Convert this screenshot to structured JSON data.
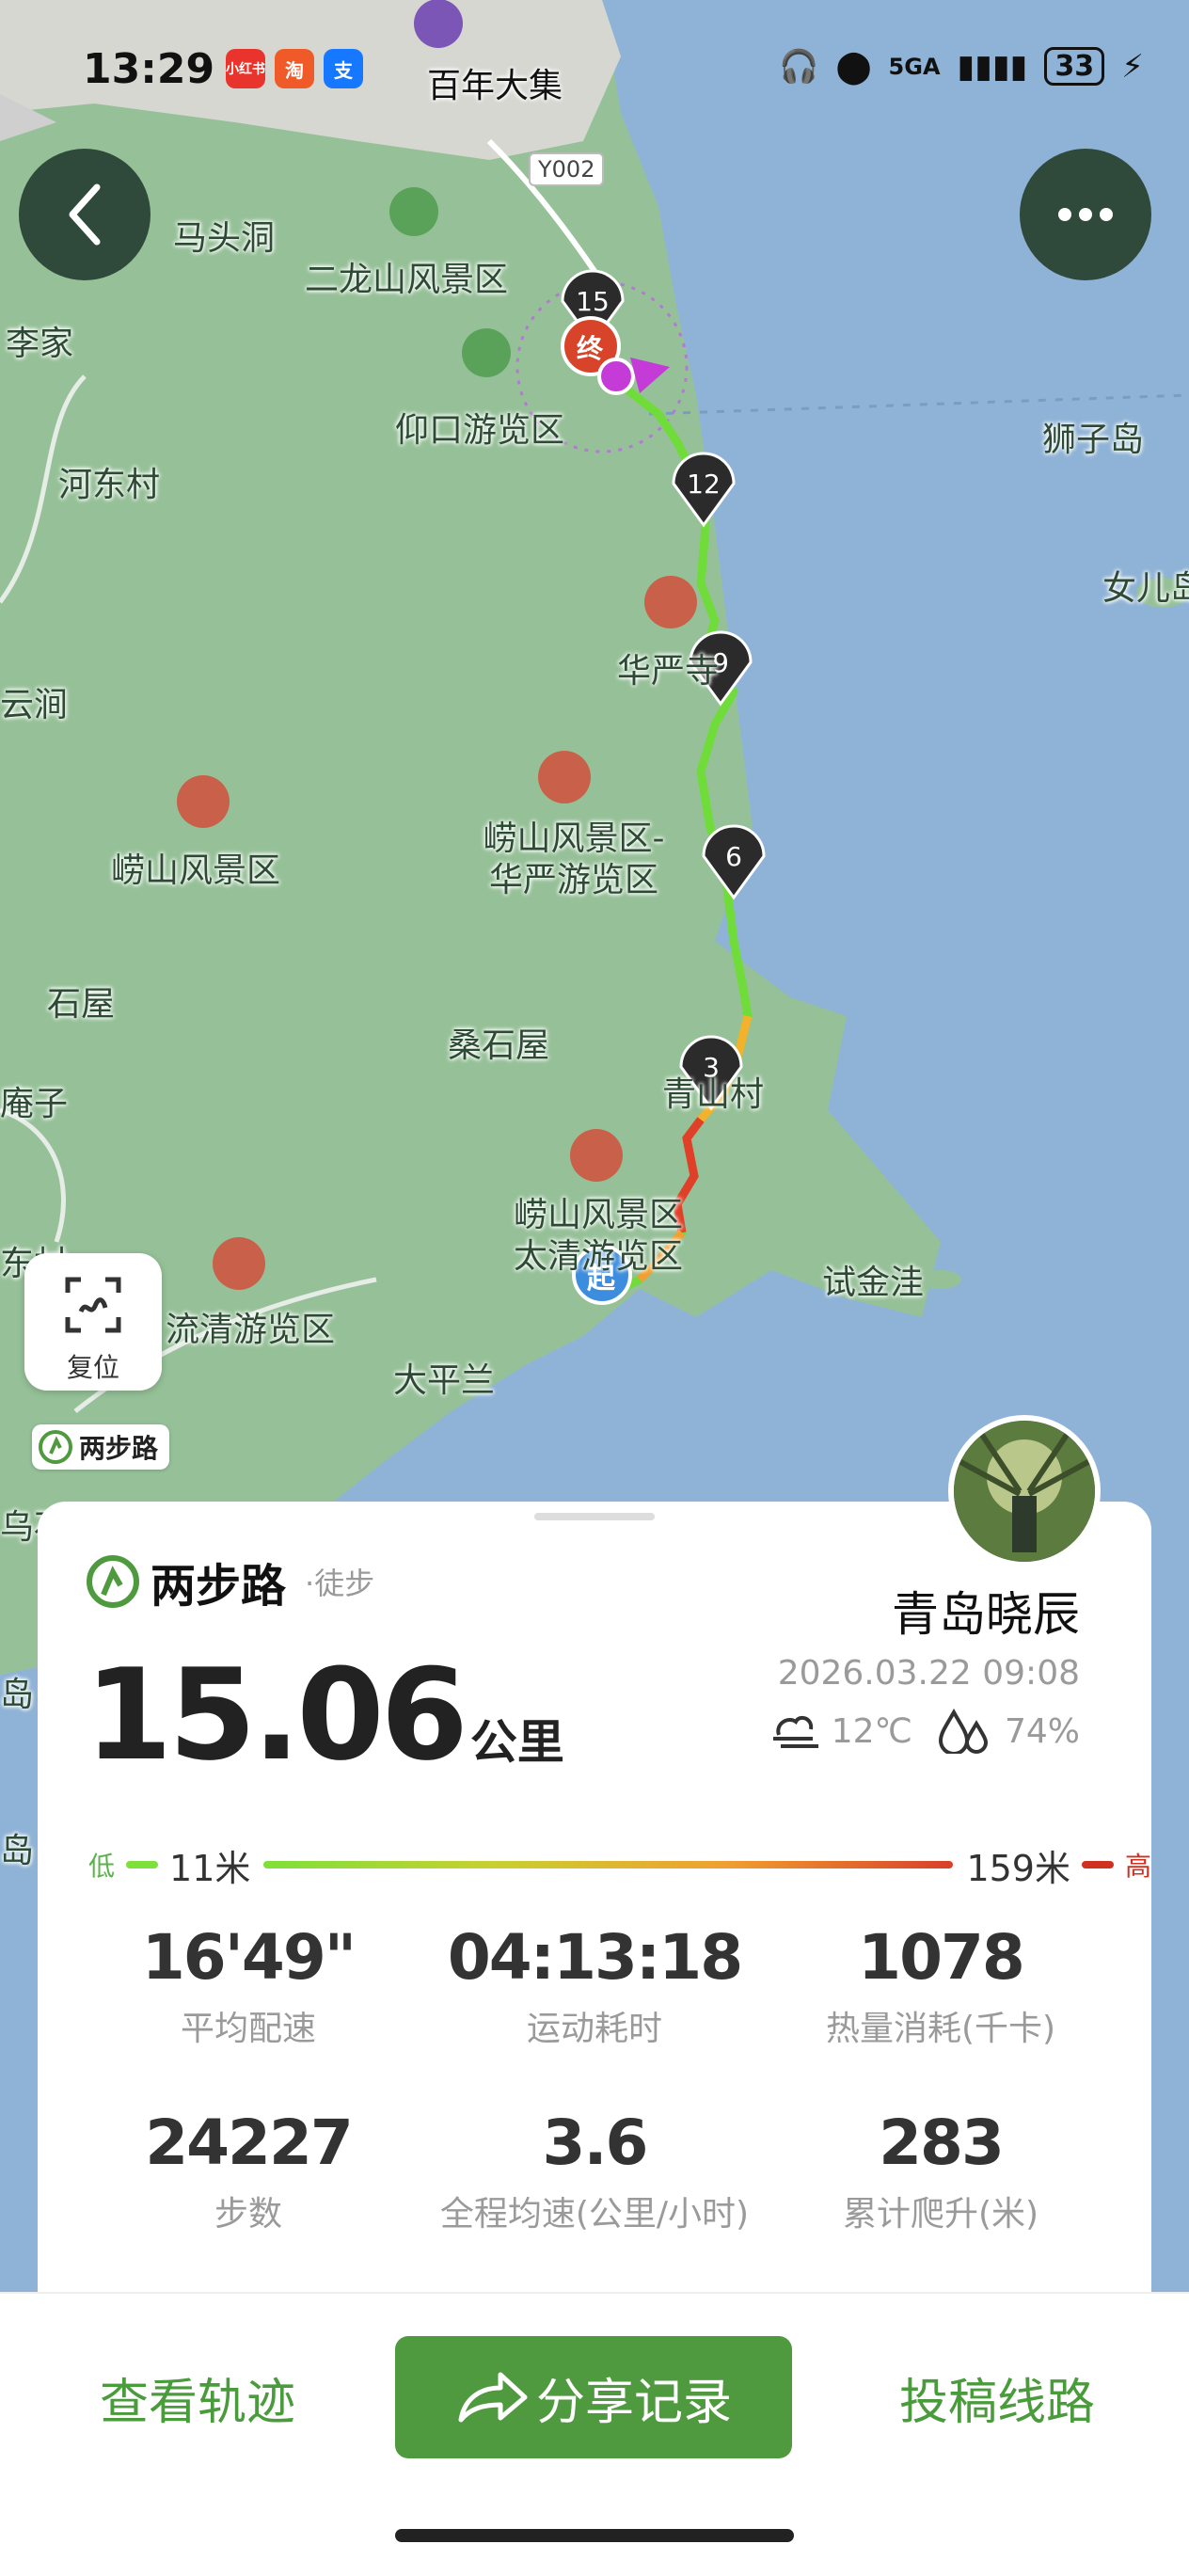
{
  "status_bar": {
    "time": "13:29",
    "apps": [
      "小红书",
      "淘",
      "支"
    ],
    "network": "5GA",
    "battery": "33"
  },
  "map": {
    "labels": {
      "top_market": "百年大集",
      "road": "Y002",
      "matouwa": "马头洞",
      "erlongshan": "二龙山风景区",
      "lijia": "李家",
      "yangkou": "仰口游览区",
      "shizidao": "狮子岛",
      "hedong": "河东村",
      "nvdao": "女儿岛",
      "yunjian": "云涧",
      "huayan": "华严寺",
      "laoshan": "崂山风景区",
      "laoshan_huayan": "崂山风景区-华严游览区",
      "shiwu": "石屋",
      "sangshiwu": "桑石屋",
      "qingshancun": "青山村",
      "anzi": "庵子",
      "laoshan_taiqing": "崂山风景区太清游览区",
      "shijinwa": "试金洼",
      "dongcun": "东村",
      "liuqing": "流清游览区",
      "taipinglan": "大平兰",
      "wu": "乌石",
      "dao": "岛",
      "dao2": "岛"
    },
    "markers": [
      "15",
      "12",
      "9",
      "6",
      "3"
    ],
    "start_label": "起",
    "end_label": "终"
  },
  "reset": {
    "label": "复位"
  },
  "watermark": {
    "label": "两步路"
  },
  "card": {
    "brand": "两步路",
    "activity_type": "·徒步",
    "username": "青岛晓辰",
    "distance": "15.06",
    "distance_unit": "公里",
    "datetime": "2026.03.22 09:08",
    "temperature": "12℃",
    "humidity": "74%",
    "elevation": {
      "low_label": "低",
      "high_label": "高",
      "min": "11米",
      "max": "159米"
    },
    "stats": [
      {
        "value": "16'49\"",
        "label": "平均配速"
      },
      {
        "value": "04:13:18",
        "label": "运动耗时"
      },
      {
        "value": "1078",
        "label": "热量消耗(千卡)"
      },
      {
        "value": "24227",
        "label": "步数"
      },
      {
        "value": "3.6",
        "label": "全程均速(公里/小时)"
      },
      {
        "value": "283",
        "label": "累计爬升(米)"
      }
    ]
  },
  "actions": {
    "view_track": "查看轨迹",
    "share": "分享记录",
    "submit_route": "投稿线路"
  }
}
